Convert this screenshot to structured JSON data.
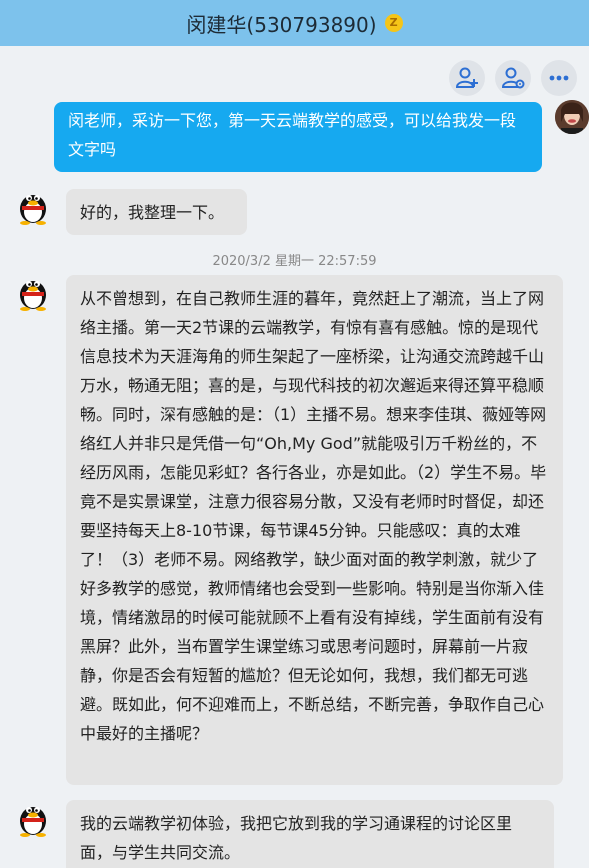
{
  "header": {
    "title": "闵建华(530793890)",
    "badge_glyph": "Z"
  },
  "actions": [
    {
      "name": "add-friend-icon"
    },
    {
      "name": "contact-settings-icon"
    },
    {
      "name": "more-icon"
    }
  ],
  "messages": [
    {
      "sender": "me",
      "text": "闵老师，采访一下您，第一天云端教学的感受，可以给我发一段文字吗"
    },
    {
      "sender": "contact",
      "text": "好的，我整理一下。"
    },
    {
      "sender": "contact",
      "timestamp": "2020/3/2 星期一 22:57:59",
      "text": "从不曾想到，在自己教师生涯的暮年，竟然赶上了潮流，当上了网络主播。第一天2节课的云端教学，有惊有喜有感触。惊的是现代信息技术为天涯海角的师生架起了一座桥梁，让沟通交流跨越千山万水，畅通无阻；喜的是，与现代科技的初次邂逅来得还算平稳顺畅。同时，深有感触的是：（1）主播不易。想来李佳琪、薇娅等网络红人并非只是凭借一句“Oh,My God”就能吸引万千粉丝的，不经历风雨，怎能见彩虹？各行各业，亦是如此。（2）学生不易。毕竟不是实景课堂，注意力很容易分散，又没有老师时时督促，却还要坚持每天上8-10节课，每节课45分钟。只能感叹：真的太难了！（3）老师不易。网络教学，缺少面对面的教学刺激，就少了好多教学的感觉，教师情绪也会受到一些影响。特别是当你渐入佳境，情绪激昂的时候可能就顾不上看有没有掉线，学生面前有没有黑屏？此外，当布置学生课堂练习或思考问题时，屏幕前一片寂静，你是否会有短暂的尴尬？但无论如何，我想，我们都无可逃避。既如此，何不迎难而上，不断总结，不断完善，争取作自己心中最好的主播呢？"
    },
    {
      "sender": "contact",
      "text": "我的云端教学初体验，我把它放到我的学习通课程的讨论区里面，与学生共同交流。"
    }
  ],
  "colors": {
    "titlebar": "#7dc2ec",
    "out_bubble": "#16a9f0",
    "in_bubble": "#e4e4e4",
    "background": "#eef1f4"
  }
}
